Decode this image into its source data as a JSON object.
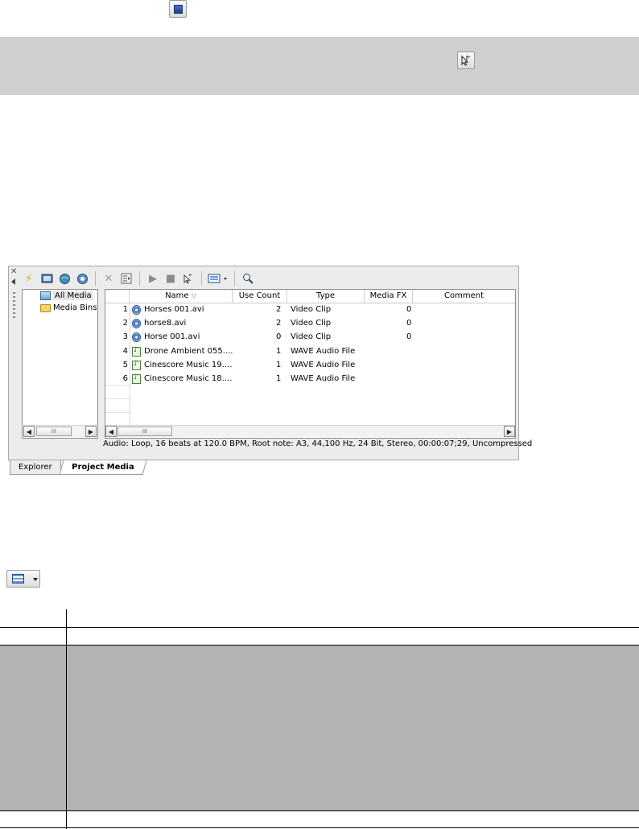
{
  "top_icon": {
    "name": "stop-icon"
  },
  "flag_icon": {
    "name": "auto-preview-flag-icon"
  },
  "media_window": {
    "toolbar_icons": [
      "import-media-icon",
      "capture-video-icon",
      "get-media-from-web-icon",
      "extract-audio-icon",
      "remove-icon",
      "properties-icon",
      "play-icon",
      "stop-icon",
      "auto-preview-icon",
      "views-icon",
      "search-icon"
    ],
    "tree": {
      "items": [
        {
          "label": "All Media",
          "icon": "media-bin-icon",
          "selected": true
        },
        {
          "label": "Media Bins",
          "icon": "folder-icon",
          "selected": false
        }
      ],
      "scroll_thumb": "III"
    },
    "columns": [
      "Name",
      "Use Count",
      "Type",
      "Media FX",
      "Comment"
    ],
    "rows": [
      {
        "num": "1",
        "name": "Horses 001.avi",
        "use_count": "2",
        "type": "Video Clip",
        "media_fx": "0",
        "kind": "video"
      },
      {
        "num": "2",
        "name": "horse8.avi",
        "use_count": "2",
        "type": "Video Clip",
        "media_fx": "0",
        "kind": "video"
      },
      {
        "num": "3",
        "name": "Horse 001.avi",
        "use_count": "0",
        "type": "Video Clip",
        "media_fx": "0",
        "kind": "video"
      },
      {
        "num": "4",
        "name": "Drone Ambient 055....",
        "use_count": "1",
        "type": "WAVE Audio File",
        "media_fx": "",
        "kind": "audio"
      },
      {
        "num": "5",
        "name": "Cinescore Music 19....",
        "use_count": "1",
        "type": "WAVE Audio File",
        "media_fx": "",
        "kind": "audio"
      },
      {
        "num": "6",
        "name": "Cinescore Music 18....",
        "use_count": "1",
        "type": "WAVE Audio File",
        "media_fx": "",
        "kind": "audio"
      }
    ],
    "list_scroll_thumb": "III",
    "status": "Audio: Loop, 16 beats at 120.0 BPM, Root note: A3, 44,100 Hz, 24 Bit, Stereo, 00:00:07;29, Uncompressed",
    "tabs": [
      {
        "label": "Explorer",
        "active": false
      },
      {
        "label": "Project Media",
        "active": true
      }
    ]
  },
  "views_button": {
    "icon": "views-icon",
    "dropdown": "chevron-down-icon"
  }
}
